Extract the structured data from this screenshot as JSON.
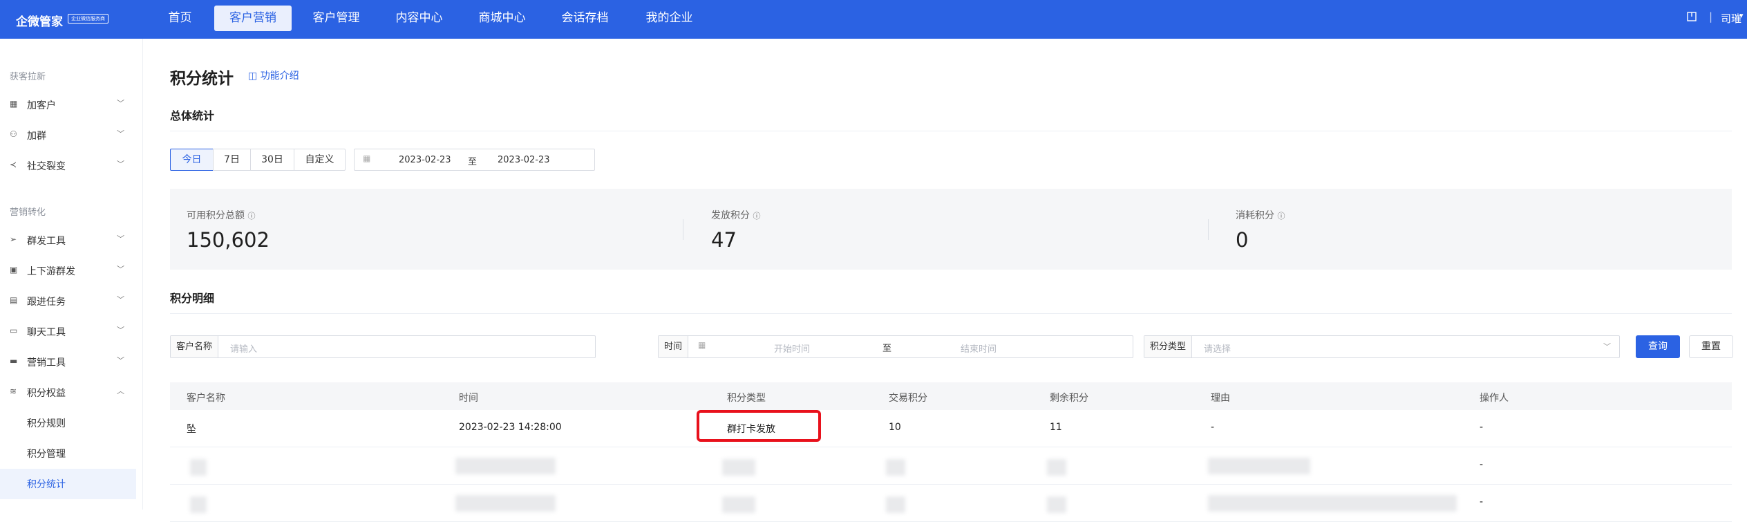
{
  "topbar": {
    "brand": "企微管家",
    "badge": "企业微信服务商",
    "nav": [
      "首页",
      "客户营销",
      "客户管理",
      "内容中心",
      "商城中心",
      "会话存档",
      "我的企业"
    ],
    "user": "司璀",
    "separator": "|"
  },
  "sidebar": {
    "group1": "获客拉新",
    "group1_items": [
      "加客户",
      "加群",
      "社交裂变"
    ],
    "group2": "营销转化",
    "group2_items": [
      "群发工具",
      "上下游群发",
      "跟进任务",
      "聊天工具",
      "营销工具",
      "积分权益"
    ],
    "sub_items": [
      "积分规则",
      "积分管理",
      "积分统计"
    ]
  },
  "page": {
    "title": "积分统计",
    "intro_link": "功能介绍",
    "overall_title": "总体统计",
    "ranges": [
      "今日",
      "7日",
      "30日",
      "自定义"
    ],
    "date_start": "2023-02-23",
    "date_sep": "至",
    "date_end": "2023-02-23",
    "stats": [
      {
        "label": "可用积分总额",
        "value": "150,602"
      },
      {
        "label": "发放积分",
        "value": "47"
      },
      {
        "label": "消耗积分",
        "value": "0"
      }
    ],
    "detail_title": "积分明细",
    "filters": {
      "customer_label": "客户名称",
      "customer_placeholder": "请输入",
      "time_label": "时间",
      "time_start_placeholder": "开始时间",
      "time_sep": "至",
      "time_end_placeholder": "结束时间",
      "type_label": "积分类型",
      "type_placeholder": "请选择"
    },
    "query_button": "查询",
    "reset_button": "重置",
    "table": {
      "headers": [
        "客户名称",
        "时间",
        "积分类型",
        "交易积分",
        "剩余积分",
        "理由",
        "操作人"
      ],
      "rows": [
        [
          "坠",
          "2023-02-23 14:28:00",
          "群打卡发放",
          "10",
          "11",
          "-",
          "-"
        ]
      ],
      "blurred_operator": [
        "-",
        "-"
      ]
    }
  },
  "colors": {
    "primary": "#2b62e3",
    "highlight": "#e8111c"
  }
}
